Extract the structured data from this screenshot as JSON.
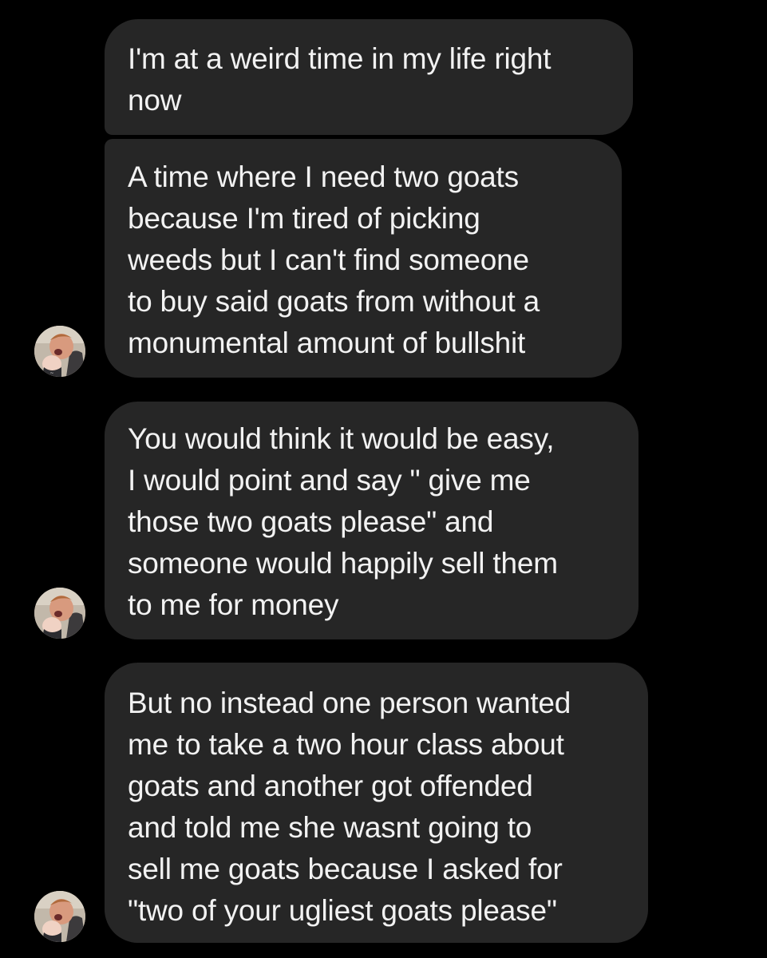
{
  "messages": [
    {
      "lines": [
        "I'm at a weird time in my life right",
        "now"
      ]
    },
    {
      "lines": [
        "A time where I need two goats",
        "because I'm tired of picking",
        "weeds but I can't find someone",
        "to buy said goats from without a",
        "monumental amount of bullshit"
      ]
    },
    {
      "lines": [
        "You would think it would be easy,",
        "I would point and say \" give me",
        "those two goats please\" and",
        "someone would happily sell them",
        "to me for money"
      ]
    },
    {
      "lines": [
        "But no instead one person wanted",
        "me to take a two hour class about",
        "goats and another got offended",
        "and told me she wasnt going to",
        "sell me goats because I asked for",
        "\"two of your ugliest goats please\""
      ]
    }
  ],
  "avatar": {
    "icon": "sender-avatar-photo"
  },
  "colors": {
    "background": "#000000",
    "bubble": "#262626",
    "text": "#f2f2f2"
  }
}
